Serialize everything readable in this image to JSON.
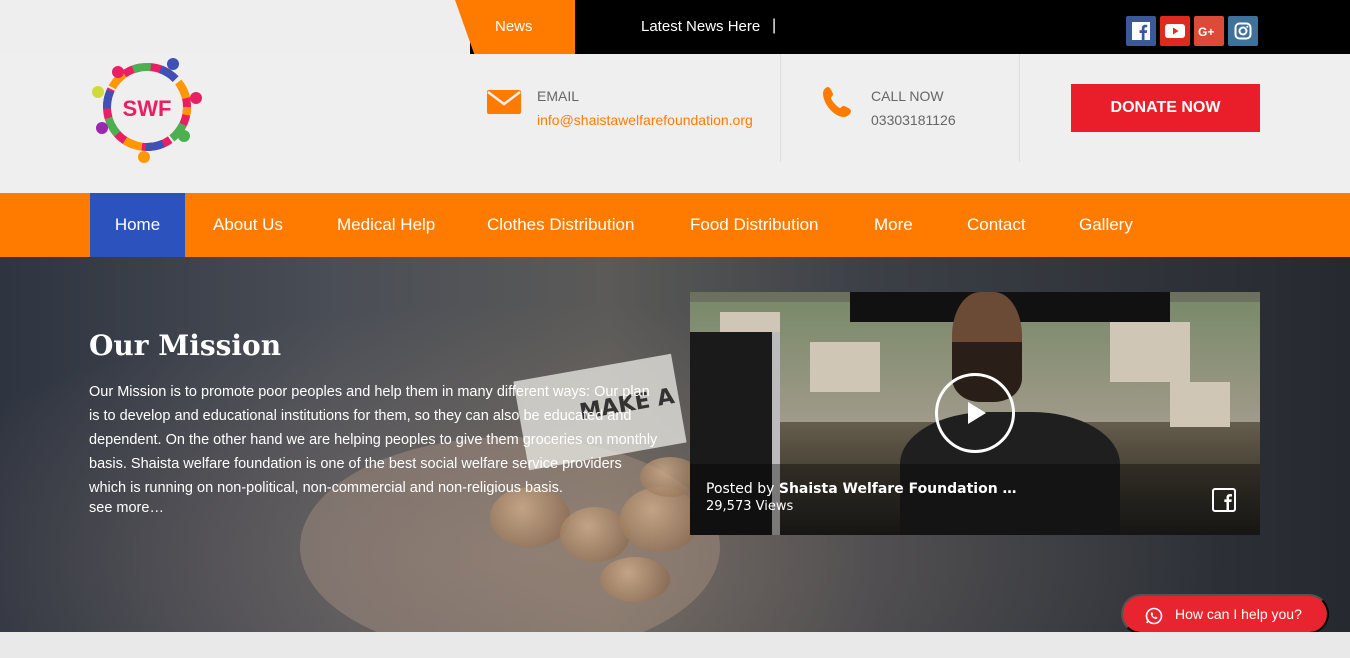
{
  "topbar": {
    "news_label": "News",
    "latest_news": "Latest News Here",
    "separator": "|",
    "social": [
      "facebook-icon",
      "youtube-icon",
      "google-plus-icon",
      "instagram-icon"
    ]
  },
  "header": {
    "logo_text": "SWF",
    "email_label": "EMAIL",
    "email_value": "info@shaistawelfarefoundation.org",
    "call_label": "CALL NOW",
    "call_value": "03303181126",
    "donate_label": "DONATE NOW"
  },
  "nav": {
    "items": [
      "Home",
      "About Us",
      "Medical Help",
      "Clothes Distribution",
      "Food Distribution",
      "More",
      "Contact",
      "Gallery"
    ],
    "active": "Home"
  },
  "hero": {
    "paper_text": "MAKE A",
    "title": "Our Mission",
    "text": "Our Mission is to promote poor peoples and help them in many different ways: Our plan is to develop and educational institutions for them, so they can also be educated and dependent. On the other hand we are helping peoples to give them groceries on monthly basis. Shaista welfare foundation is one of the best social welfare service providers which is running on non-political, non-commercial and non-religious basis.",
    "see_more": "see more…"
  },
  "video": {
    "posted_by": "Posted by",
    "author": "Shaista Welfare Foundation …",
    "views": "29,573 Views"
  },
  "chat": {
    "label": "How can I help you?"
  },
  "colors": {
    "accent": "#ff7b00",
    "active_nav": "#2b52bd",
    "donate": "#ea1e2b",
    "topbar": "#000000"
  }
}
